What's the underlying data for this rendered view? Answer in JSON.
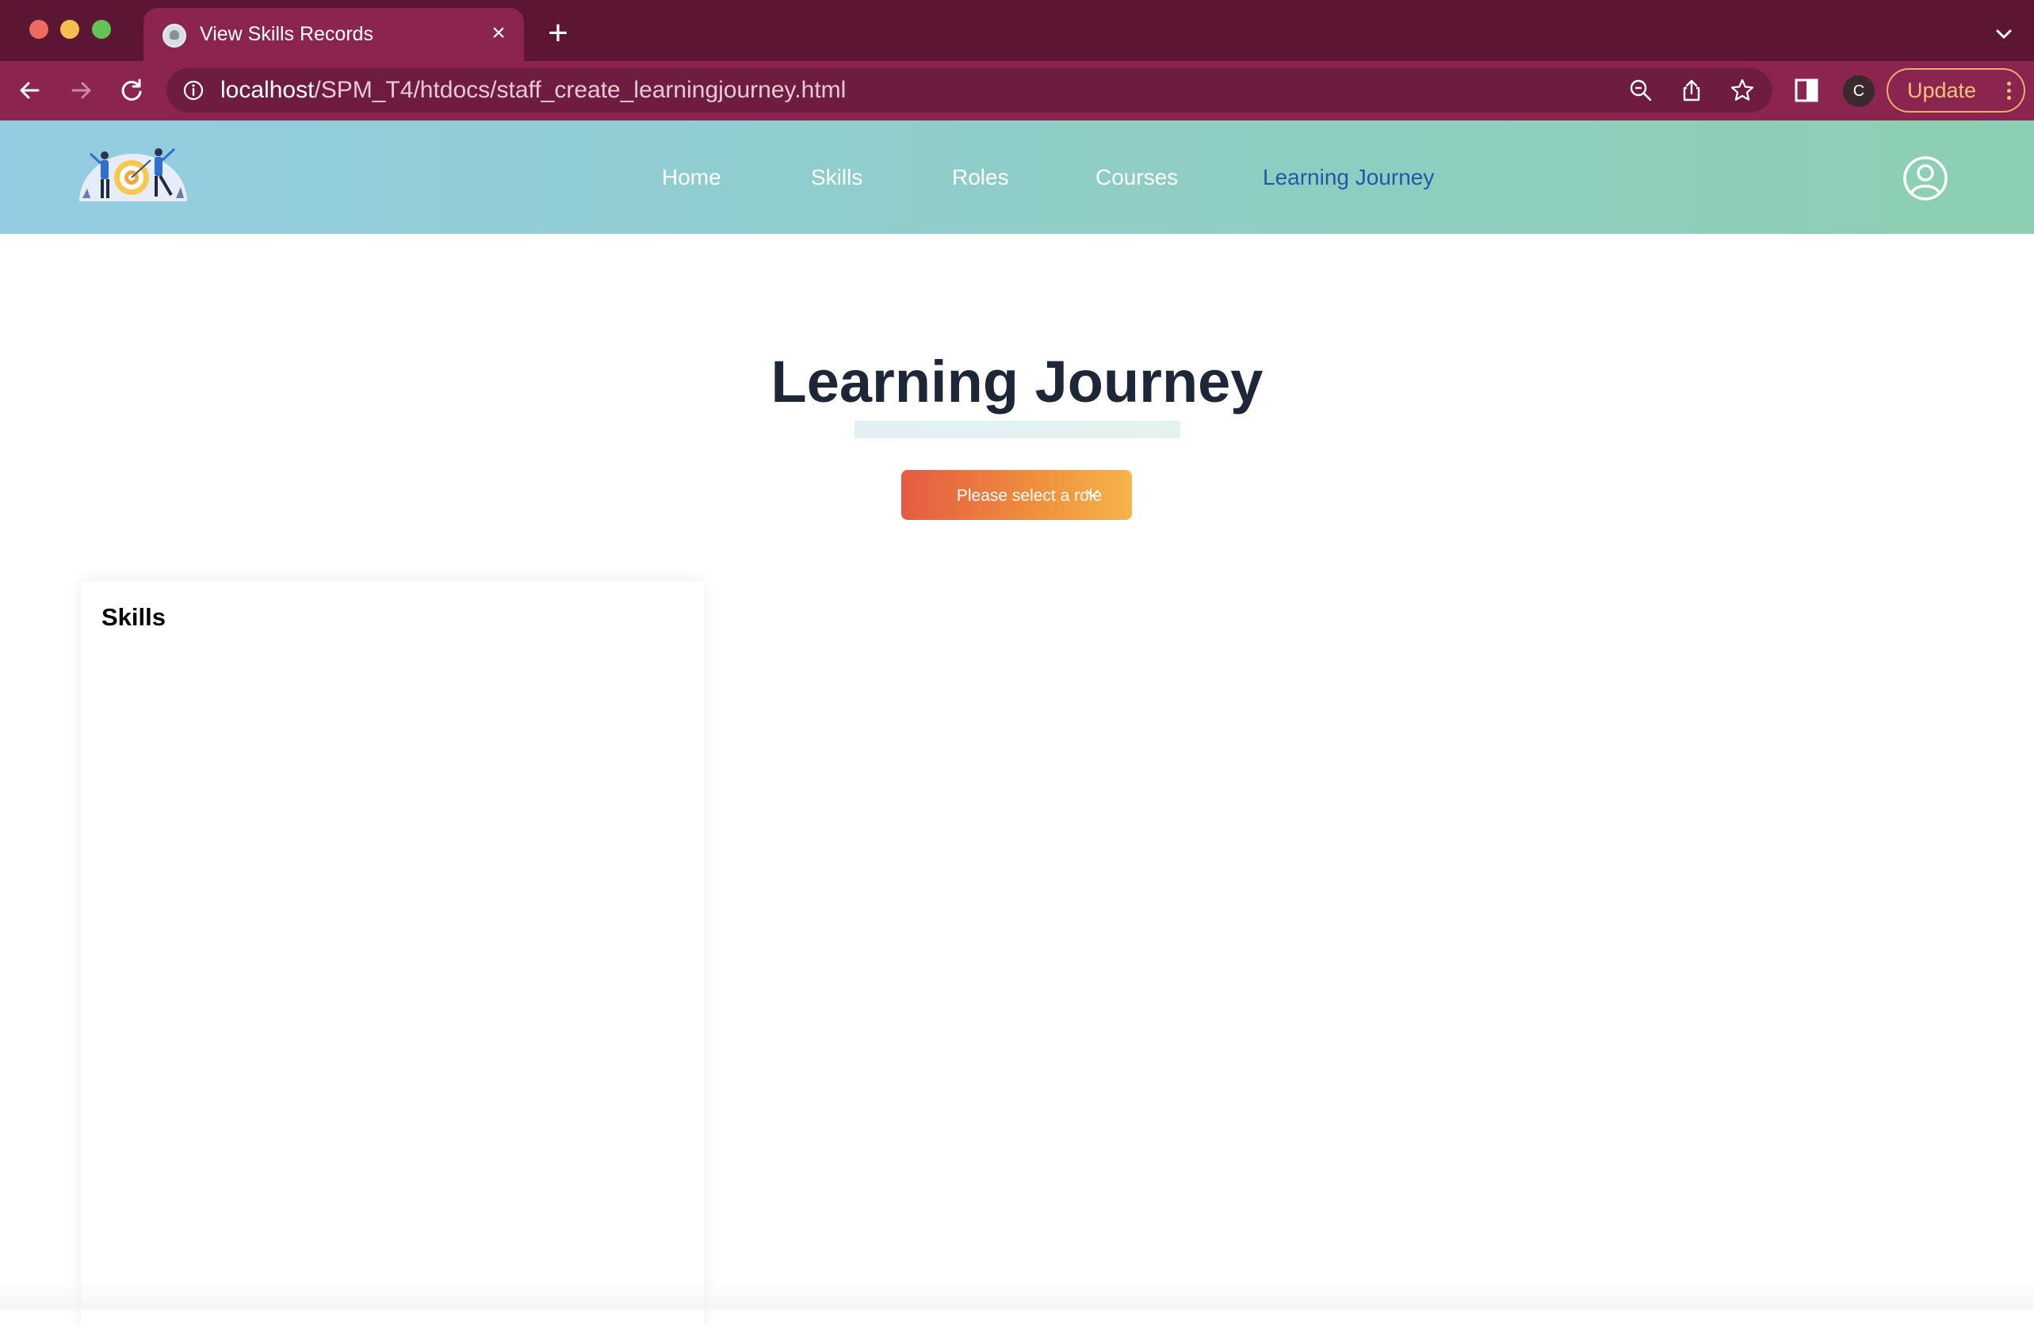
{
  "browser": {
    "tab": {
      "title": "View Skills Records",
      "favicon": "elephant-icon",
      "close_glyph": "×"
    },
    "new_tab_glyph": "+",
    "address": {
      "host": "localhost",
      "path": "/SPM_T4/htdocs/staff_create_learningjourney.html"
    },
    "profile_initial": "C",
    "update_label": "Update"
  },
  "header": {
    "logo": "team-target-logo",
    "nav": [
      {
        "label": "Home",
        "active": false
      },
      {
        "label": "Skills",
        "active": false
      },
      {
        "label": "Roles",
        "active": false
      },
      {
        "label": "Courses",
        "active": false
      },
      {
        "label": "Learning Journey",
        "active": true
      }
    ],
    "profile_icon": "user-circle-icon"
  },
  "main": {
    "title": "Learning Journey",
    "role_select": {
      "label": "Please select a role",
      "icon": "chevron-down-icon"
    },
    "skills_panel": {
      "heading": "Skills"
    }
  },
  "colors": {
    "tabbar": "#5c1533",
    "toolbar": "#8c2450",
    "header_gradient_start": "#94cde3",
    "header_gradient_end": "#8dcfb2",
    "nav_active": "#2655a8",
    "button_gradient_start": "#e45a43",
    "button_gradient_end": "#f5b44a",
    "title_text": "#1d2737"
  }
}
